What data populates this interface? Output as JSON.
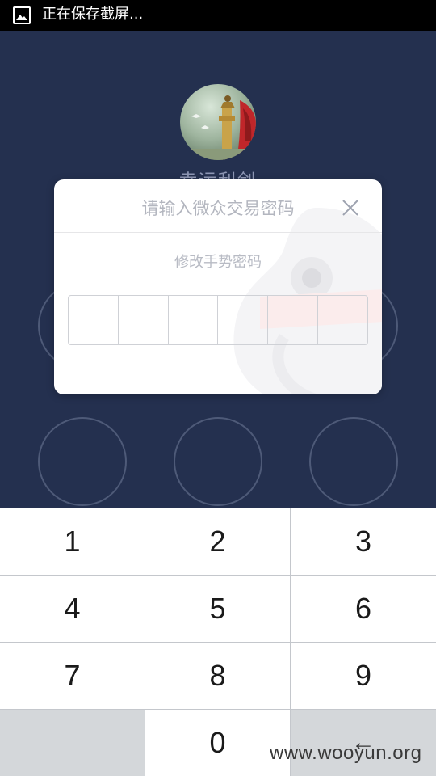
{
  "status_bar": {
    "text": "正在保存截屏...",
    "icon": "screenshot-image-icon"
  },
  "background": {
    "username": "幸运利剑",
    "avatar_icon": "avatar-monument-icon"
  },
  "dialog": {
    "title": "请输入微众交易密码",
    "close_icon": "close-icon",
    "subtitle": "修改手势密码",
    "pin_length": 6
  },
  "keypad": {
    "keys": [
      "1",
      "2",
      "3",
      "4",
      "5",
      "6",
      "7",
      "8",
      "9",
      "",
      "0",
      "←"
    ]
  },
  "watermark": "www.wooyun.org",
  "colors": {
    "background": "#24304f",
    "dialog": "#ffffff",
    "key": "#ffffff",
    "key_blank": "#d4d7da"
  }
}
